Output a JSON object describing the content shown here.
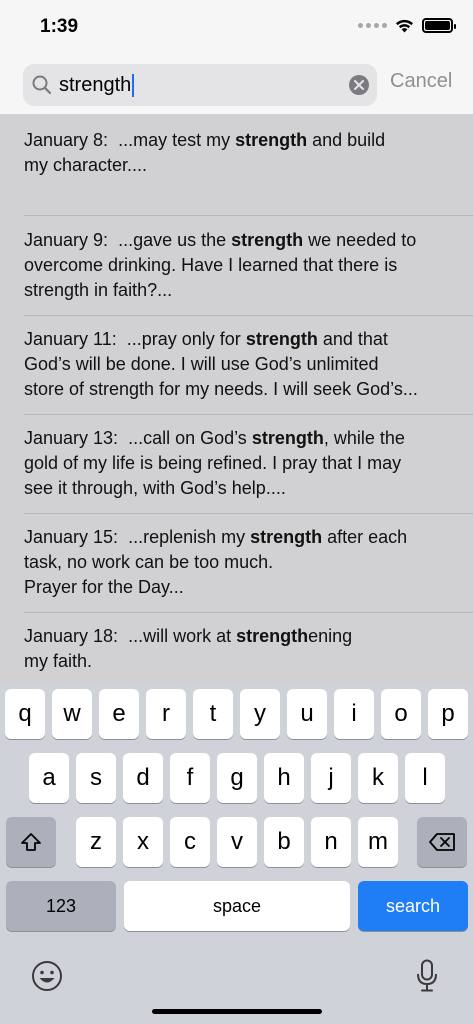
{
  "status": {
    "time": "1:39"
  },
  "search": {
    "query": "strength",
    "cancel_label": "Cancel"
  },
  "results": [
    {
      "date": "January 8:",
      "lines": [
        [
          {
            "t": "...may test my "
          },
          {
            "t": "strength",
            "b": true
          },
          {
            "t": " and build"
          }
        ],
        [
          {
            "t": "my character...."
          }
        ]
      ]
    },
    {
      "date": "January 9:",
      "lines": [
        [
          {
            "t": "...gave us the "
          },
          {
            "t": "strength",
            "b": true
          },
          {
            "t": " we needed to"
          }
        ],
        [
          {
            "t": "overcome drinking. Have I learned that there is"
          }
        ],
        [
          {
            "t": "strength in faith?..."
          }
        ]
      ]
    },
    {
      "date": "January 11:",
      "lines": [
        [
          {
            "t": "...pray only for "
          },
          {
            "t": "strength",
            "b": true
          },
          {
            "t": " and that"
          }
        ],
        [
          {
            "t": "God’s will be done. I will use God’s unlimited"
          }
        ],
        [
          {
            "t": "store of strength for my needs. I will seek God’s..."
          }
        ]
      ]
    },
    {
      "date": "January 13:",
      "lines": [
        [
          {
            "t": "...call on God’s "
          },
          {
            "t": "strength",
            "b": true
          },
          {
            "t": ", while the"
          }
        ],
        [
          {
            "t": "gold of my life is being refined. I pray that I may"
          }
        ],
        [
          {
            "t": "see it through, with God’s help...."
          }
        ]
      ]
    },
    {
      "date": "January 15:",
      "lines": [
        [
          {
            "t": "...replenish my "
          },
          {
            "t": "strength",
            "b": true
          },
          {
            "t": " after each"
          }
        ],
        [
          {
            "t": "task, no work can be too much."
          }
        ],
        [
          {
            "t": "Prayer for the Day..."
          }
        ]
      ]
    },
    {
      "date": "January 18:",
      "lines": [
        [
          {
            "t": "...will work at "
          },
          {
            "t": "strength",
            "b": true
          },
          {
            "t": "ening"
          }
        ],
        [
          {
            "t": "my faith."
          }
        ]
      ]
    }
  ],
  "keyboard": {
    "row1": [
      "q",
      "w",
      "e",
      "r",
      "t",
      "y",
      "u",
      "i",
      "o",
      "p"
    ],
    "row2": [
      "a",
      "s",
      "d",
      "f",
      "g",
      "h",
      "j",
      "k",
      "l"
    ],
    "row3": [
      "z",
      "x",
      "c",
      "v",
      "b",
      "n",
      "m"
    ],
    "numbers_label": "123",
    "space_label": "space",
    "search_label": "search"
  }
}
